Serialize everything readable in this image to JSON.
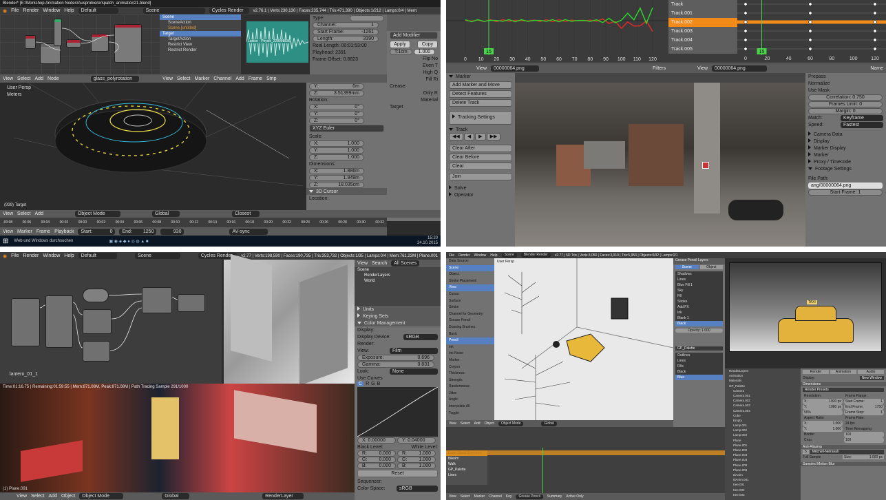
{
  "q1": {
    "title": "Blender* [E:\\Workshop Animation Nodes\\Ausprobieren\\patch_animation21.blend]",
    "menu": [
      "File",
      "Render",
      "Window",
      "Help"
    ],
    "layout": "Default",
    "scene": "Scene",
    "engine": "Cycles Render",
    "stats": "v2.76.1 | Verts:230,130 | Faces:235,744 | Tris:471,390 | Objects:1/212 | Lamps:0/4 | Mem:",
    "outliner": [
      "Scene",
      "SceneAction",
      "Scene.[untitled]",
      "Target",
      "TargetAction",
      "Restrict View",
      "Restrict Render"
    ],
    "seq_label": "Lattice - Physik_228998836",
    "props": {
      "type": "Type:",
      "channel": "Channel:",
      "channel_v": "1",
      "start": "Start Frame:",
      "start_v": "-1261",
      "length": "Length:",
      "length_v": "3390",
      "real_length": "Real Length: 00:01:53:00",
      "playhead": "Playhead: 2391",
      "offset": "Frame Offset: 0.8823"
    },
    "modifier": {
      "add": "Add Modifier",
      "apply": "Apply",
      "copy": "Copy",
      "ti": "T:1cm",
      "ti_v": "1.000",
      "flip": "Flip No",
      "even": "Even T",
      "high": "High Q",
      "fill": "Fill Ri",
      "crease": "Crease:",
      "only": "Only R",
      "material": "Material",
      "target": "Target"
    },
    "viewport": {
      "mode": "User Persp",
      "units": "Meters",
      "frame": "(939) Target",
      "objmode": "Object Mode",
      "global": "Global",
      "closest": "Closest"
    },
    "nprops": {
      "y": "Y:",
      "y_v": "0m",
      "z": "Z:",
      "z_v": "3.51399mm",
      "rotation": "Rotation:",
      "rx": "X:",
      "rx_v": "0°",
      "ry": "Y:",
      "ry_v": "0°",
      "rz": "Z:",
      "rz_v": "0°",
      "euler": "XYZ Euler",
      "scale": "Scale:",
      "sx": "X:",
      "sx_v": "1.000",
      "sy": "Y:",
      "sy_v": "1.000",
      "sz": "Z:",
      "sz_v": "1.000",
      "dims": "Dimensions:",
      "dx": "X:",
      "dx_v": "1.886m",
      "dy": "Y:",
      "dy_v": "1.949m",
      "dz": "Z:",
      "dz_v": "18.035cm",
      "cursor": "3D Cursor",
      "location": "Location:"
    },
    "node_header": [
      "View",
      "Select",
      "Add",
      "Node"
    ],
    "material": "glass_polyrotation",
    "seq_header": [
      "View",
      "Select",
      "Marker",
      "Channel",
      "Add",
      "Frame",
      "Strip"
    ],
    "timeline": {
      "items": [
        "View",
        "Marker",
        "Frame",
        "Playback"
      ],
      "start": "Start:",
      "start_v": "0",
      "end": "End:",
      "end_v": "1250",
      "frame_v": "930",
      "sync": "AV-sync"
    },
    "timecodes": [
      "-00:08",
      "00:06",
      "00:04",
      "00:02",
      "00:00",
      "00:02",
      "00:04",
      "00:06",
      "00:08",
      "00:10",
      "00:12",
      "00:14",
      "00:16",
      "00:18",
      "00:20",
      "00:22",
      "00:24",
      "00:26",
      "00:28",
      "00:30",
      "00:32"
    ],
    "taskbar": {
      "search": "Web und Windows durchsuchen",
      "time": "15:20",
      "date": "24.10.2015"
    }
  },
  "q2": {
    "tracks": [
      "Track",
      "Track.001",
      "Track.002",
      "Track.003",
      "Track.004",
      "Track.005"
    ],
    "graph_ticks": [
      "0",
      "10",
      "20",
      "30",
      "40",
      "50",
      "60",
      "70",
      "80",
      "90",
      "100",
      "110",
      "120"
    ],
    "dope_ticks": [
      "0",
      "20",
      "40",
      "60",
      "80",
      "100",
      "120"
    ],
    "frame_badge": "15",
    "header_left": {
      "view": "View",
      "clip": "00000064.png",
      "filters": "Filters"
    },
    "header_right": {
      "view": "View",
      "clip": "00000064.png",
      "name": "Name"
    },
    "tools": {
      "marker": "Marker",
      "add_move": "Add Marker and Move",
      "detect": "Detect Features",
      "delete": "Delete Track",
      "tracking_settings": "Tracking Settings",
      "track": "Track",
      "clear_after": "Clear After",
      "clear_before": "Clear Before",
      "clear": "Clear",
      "join": "Join",
      "solve": "Solve",
      "operator": "Operator"
    },
    "panel": {
      "prepass": "Prepass",
      "normalize": "Normalize",
      "use_mask": "Use Mask",
      "correlation": "Correlation: 0.750",
      "frames_limit": "Frames Limit: 0",
      "margin": "Margin: 0",
      "match": "Match:",
      "match_v": "Keyframe",
      "speed": "Speed:",
      "speed_v": "Fastest",
      "camera_data": "Camera Data",
      "display": "Display",
      "marker_display": "Marker Display",
      "marker": "Marker",
      "proxy": "Proxy / Timecode",
      "footage": "Footage Settings",
      "file_path": "File Path:",
      "file_path_v": "ang/00000064.png",
      "start_frame": "Start Frame: 1"
    }
  },
  "q3": {
    "menu": [
      "File",
      "Render",
      "Window",
      "Help"
    ],
    "layout": "Default",
    "scene": "Scene",
    "engine": "Cycles Render",
    "stats": "v2.77 | Verts:198,590 | Faces:190,735 | Tris:353,732 | Objects:1/35 | Lamps:0/4 | Mem:761.23M | Plane.001",
    "outliner": {
      "view": "View",
      "search": "Search",
      "all": "All Scenes",
      "items": [
        "Scene",
        "RenderLayers",
        "World"
      ]
    },
    "props": {
      "units": "Units",
      "keying": "Keying Sets",
      "color_mgmt": "Color Management",
      "display": "Display:",
      "display_device": "Display Device:",
      "display_device_v": "sRGB",
      "render": "Render:",
      "view": "View:",
      "view_v": "Film",
      "exposure": "Exposure:",
      "exposure_v": "0.696",
      "gamma": "Gamma:",
      "gamma_v": "0.831",
      "look": "Look:",
      "look_v": "None",
      "use_curves": "Use Curves",
      "c": "C",
      "r": "R",
      "g": "G",
      "b": "B",
      "x_v": "X: 0.00000",
      "y_v": "Y: 0.04000",
      "black": "Black Level:",
      "white": "White Level:",
      "br": "R:",
      "br_v": "0.000",
      "bg": "G:",
      "bg_v": "0.000",
      "bb": "B:",
      "bb_v": "0.000",
      "wr": "R:",
      "wr_v": "1.000",
      "wg": "G:",
      "wg_v": "1.000",
      "wb": "B:",
      "wb_v": "1.000",
      "reset": "Reset",
      "sequencer": "Sequencer:",
      "color_space": "Color Space:",
      "color_space_v": "sRGB"
    },
    "node_label": "lantern_01_1",
    "render_status": "Time:01:16.75 | Remaining:01:59:55 | Mem:871.08M, Peak:871.08M | Path Tracing Sample 291/1000",
    "frame": "(1) Plane.091",
    "bottom": [
      "View",
      "Select",
      "Add",
      "Object"
    ],
    "objmode": "Object Mode",
    "global": "Global",
    "renderlayer": "RenderLayer",
    "node_nodes": [
      "Light Path",
      "Mix",
      "Emission",
      "Image Texture",
      "Material Output",
      "Bright/Contrast",
      "Multiply"
    ]
  },
  "q4": {
    "menu": [
      "File",
      "Render",
      "Window",
      "Help"
    ],
    "scene": "Scene",
    "engine": "Blender Render",
    "stats": "v2.77 | 5D Tris | Verts:3,050 | Faces:3,010 | Tris:5,953 | Objects:0/32 | Lamps:0/1",
    "view_label": "User Persp",
    "gp_panel": {
      "title": "Grease Pencil Layers",
      "scene": "Scene",
      "object": "Object",
      "layers": [
        "Shadows",
        "Lines",
        "Blue Fill 1",
        "Sky",
        "Fill",
        "Stroke",
        "Add FX",
        "Ink",
        "Blank 1",
        "Black"
      ],
      "opacity": "Opacity: 1.000",
      "gp_palette": "GP_Palette",
      "palette": [
        "Outlines",
        "Lines",
        "Fills",
        "Black",
        "Blue"
      ]
    },
    "left_panel": [
      "Data Source:",
      "Scene",
      "Object",
      "Stroke Placement:",
      "View",
      "Cursor",
      "Surface",
      "Stroke",
      "Channel for Geometry",
      "Grease Pencil",
      "Drawing Brushes",
      "Basic",
      "Pencil",
      "Ink",
      "Ink Noise",
      "Marker",
      "Crayon",
      "Thickness:",
      "Strength:",
      "Randomness:",
      "Jitter:",
      "Angle:",
      "Interpolate All",
      "Toggle"
    ],
    "outliner": [
      "RenderLayers",
      "Animation",
      "Materials",
      "GP_Palette",
      "Camera",
      "Camera.001",
      "Camera.002",
      "Camera.003",
      "Camera.004",
      "Cube",
      "Empty",
      "Lamp.001",
      "Lamp.002",
      "Lamp.003",
      "Plane",
      "Plane.001",
      "Plane.002",
      "Plane.003",
      "Plane.004",
      "Plane.005",
      "Plane.006",
      "ttiAnim",
      "ttiAnim.001",
      "tree.001",
      "tree.002",
      "tree.003"
    ],
    "taxi": "TAXI",
    "props_right": {
      "render": "Render",
      "animation": "Animation",
      "audio": "Audio",
      "display": "Display:",
      "display_v": "New Window",
      "dimensions": "Dimensions",
      "preset": "Render Presets",
      "resolution": "Resolution:",
      "frame_range": "Frame Range:",
      "res_x": "X:",
      "res_x_v": "1920 px",
      "res_y": "Y:",
      "res_y_v": "1080 px",
      "pct": "50%",
      "start": "Start Frame:",
      "start_v": "1",
      "end": "End Frame:",
      "end_v": "1750",
      "step": "Frame Step:",
      "step_v": "1",
      "aspect": "Aspect Ratio:",
      "frame_rate": "Frame Rate:",
      "ax": "X:",
      "ax_v": "1.000",
      "ay": "Y:",
      "ay_v": "1.000",
      "fps": "24 fps",
      "border": "Border",
      "crop": "Crop",
      "time_remap": "Time Remapping",
      "old": "100",
      "new": "100",
      "antialiasing": "Anti-Aliasing",
      "mitchell": "Mitchell-Netravali",
      "full_sample": "Full Sample",
      "size": "Size:",
      "size_v": "1.000 px",
      "sampled": "Sampled Motion Blur",
      "n": "5",
      "objmode": "Object Mode",
      "global": "Global"
    },
    "dope": {
      "rows": [
        "Dope Sheet Summary",
        "ttiAnim",
        "Walk",
        "GP_Palette",
        "Lines"
      ],
      "header": [
        "View",
        "Select",
        "Marker",
        "Channel",
        "Key"
      ],
      "mode": "Grease Pencil",
      "summary": "Summary",
      "active": "Active Only"
    },
    "bottom": [
      "View",
      "Select",
      "Add",
      "Object"
    ],
    "objmode": "Object Mode",
    "global": "Global"
  },
  "colors": {
    "bg": "#393939",
    "header": "#5a5a5a",
    "panel": "#727272",
    "accent_orange": "#f28a1a",
    "accent_blue": "#5680c2",
    "track_red": "#e02a2a",
    "track_green": "#2bd32b",
    "playhead": "#4bd24b"
  }
}
